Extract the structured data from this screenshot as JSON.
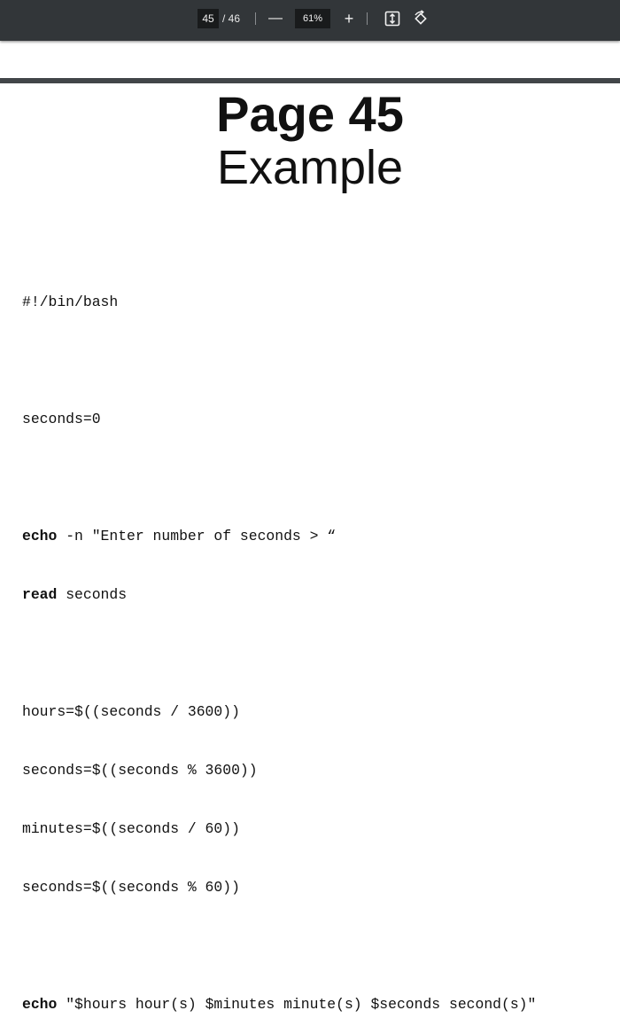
{
  "toolbar": {
    "current_page": "45",
    "page_total": "/ 46",
    "zoom_out_label": "—",
    "zoom_value": "61%",
    "zoom_in_label": "+",
    "fit_icon": "fit-page-icon",
    "rotate_icon": "rotate-icon"
  },
  "document": {
    "title": "Page 45",
    "subtitle": "Example",
    "code": {
      "shebang": "#!/bin/bash",
      "line_seconds_init": "seconds=0",
      "echo_kw": "echo",
      "echo_rest": " -n \"Enter number of seconds > “",
      "read_kw": "read",
      "read_rest": " seconds",
      "line_hours": "hours=$((seconds / 3600))",
      "line_seconds_mod_hour": "seconds=$((seconds % 3600))",
      "line_minutes": "minutes=$((seconds / 60))",
      "line_seconds_mod_min": "seconds=$((seconds % 60))",
      "final_echo_kw": "echo",
      "final_echo_rest": " \"$hours hour(s) $minutes minute(s) $seconds second(s)\""
    }
  }
}
